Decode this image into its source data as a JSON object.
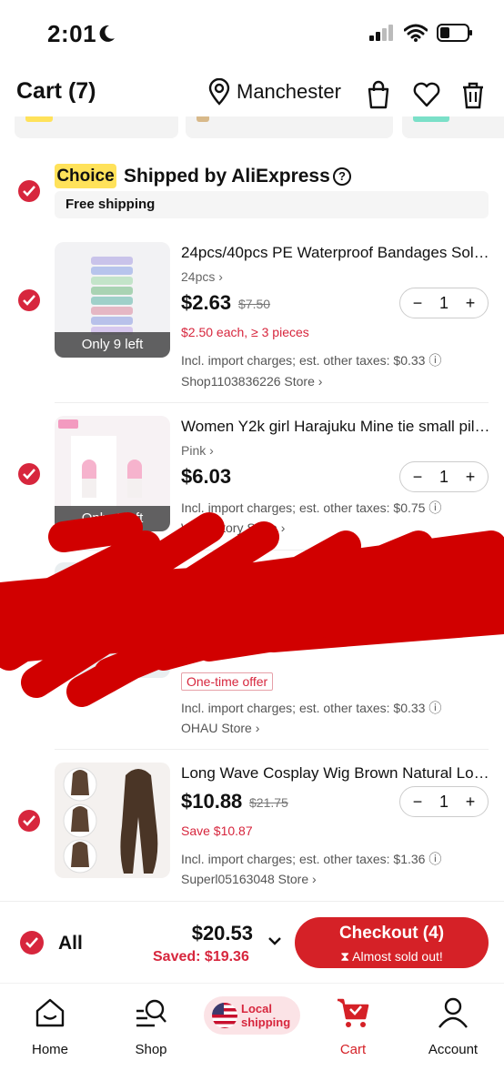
{
  "status_bar": {
    "time": "2:01"
  },
  "header": {
    "title": "Cart (7)",
    "location": "Manchester"
  },
  "choice_section": {
    "badge": "Choice",
    "title": "Shipped by AliExpress",
    "help": "?",
    "free_shipping": "Free shipping"
  },
  "items": [
    {
      "title": "24pcs/40pcs PE Waterproof Bandages Sol…",
      "variant": "24pcs",
      "price": "$2.63",
      "old_price": "$7.50",
      "promo": "$2.50 each, ≥ 3 pieces",
      "tax": "Incl. import charges; est. other taxes: $0.33",
      "store": "Shop1103836226 Store",
      "stock": "Only 9 left",
      "qty": "1"
    },
    {
      "title": "Women Y2k girl Harajuku Mine tie small pil…",
      "variant": "Pink",
      "price": "$6.03",
      "tax": "Incl. import charges; est. other taxes: $0.75",
      "store": "W… …tory Store",
      "stock": "Only 4 left",
      "qty": "1"
    },
    {
      "offer": "One-time offer",
      "tax": "Incl. import charges; est. other taxes: $0.33",
      "store": "OHAU Store"
    },
    {
      "title": "Long Wave Cosplay Wig Brown Natural Lo…",
      "price": "$10.88",
      "old_price": "$21.75",
      "promo": "Save $10.87",
      "tax": "Incl. import charges; est. other taxes: $1.36",
      "store": "Superl05163048 Store",
      "qty": "1"
    }
  ],
  "bottom": {
    "all_label": "All",
    "total": "$20.53",
    "saved": "Saved: $19.36",
    "checkout": "Checkout (4)",
    "checkout_sub": "Almost sold out!"
  },
  "tabbar": {
    "home": "Home",
    "shop": "Shop",
    "local_shipping": "Local shipping",
    "cart": "Cart",
    "account": "Account"
  },
  "colors": {
    "accent": "#d7263d",
    "choice_yellow": "#ffe25a",
    "checkout_red": "#d52127"
  }
}
